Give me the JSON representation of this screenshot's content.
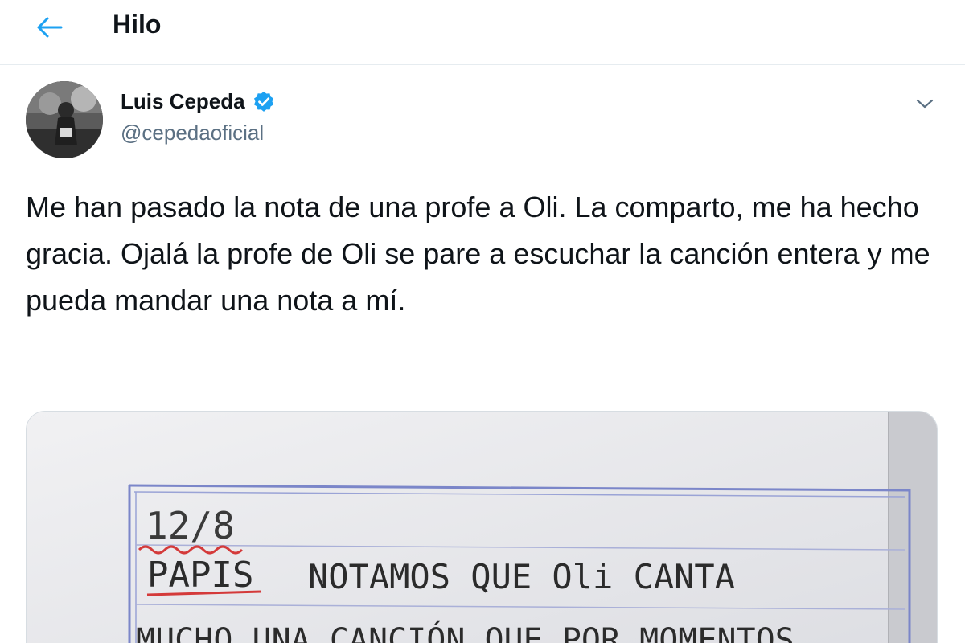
{
  "header": {
    "title": "Hilo",
    "back_icon": "arrow-left-icon",
    "accent": "#1da1f2"
  },
  "tweet": {
    "author": {
      "display_name": "Luis Cepeda",
      "handle": "@cepedaoficial",
      "verified": true,
      "verified_icon": "verified-badge-icon"
    },
    "menu_icon": "chevron-down-icon",
    "text": "Me han pasado la nota de una profe a Oli. La comparto, me ha hecho gracia. Ojalá la profe de Oli se pare a escuchar la canción entera y me pueda mandar una nota a mí.",
    "media": {
      "note_date": "12/8",
      "note_line1_label": "PAPIS",
      "note_line1_text": "NOTAMOS QUE Oli CANTA",
      "note_line2_text": "MUCHO UNA CANCIÓN QUE POR MOMENTOS"
    }
  }
}
